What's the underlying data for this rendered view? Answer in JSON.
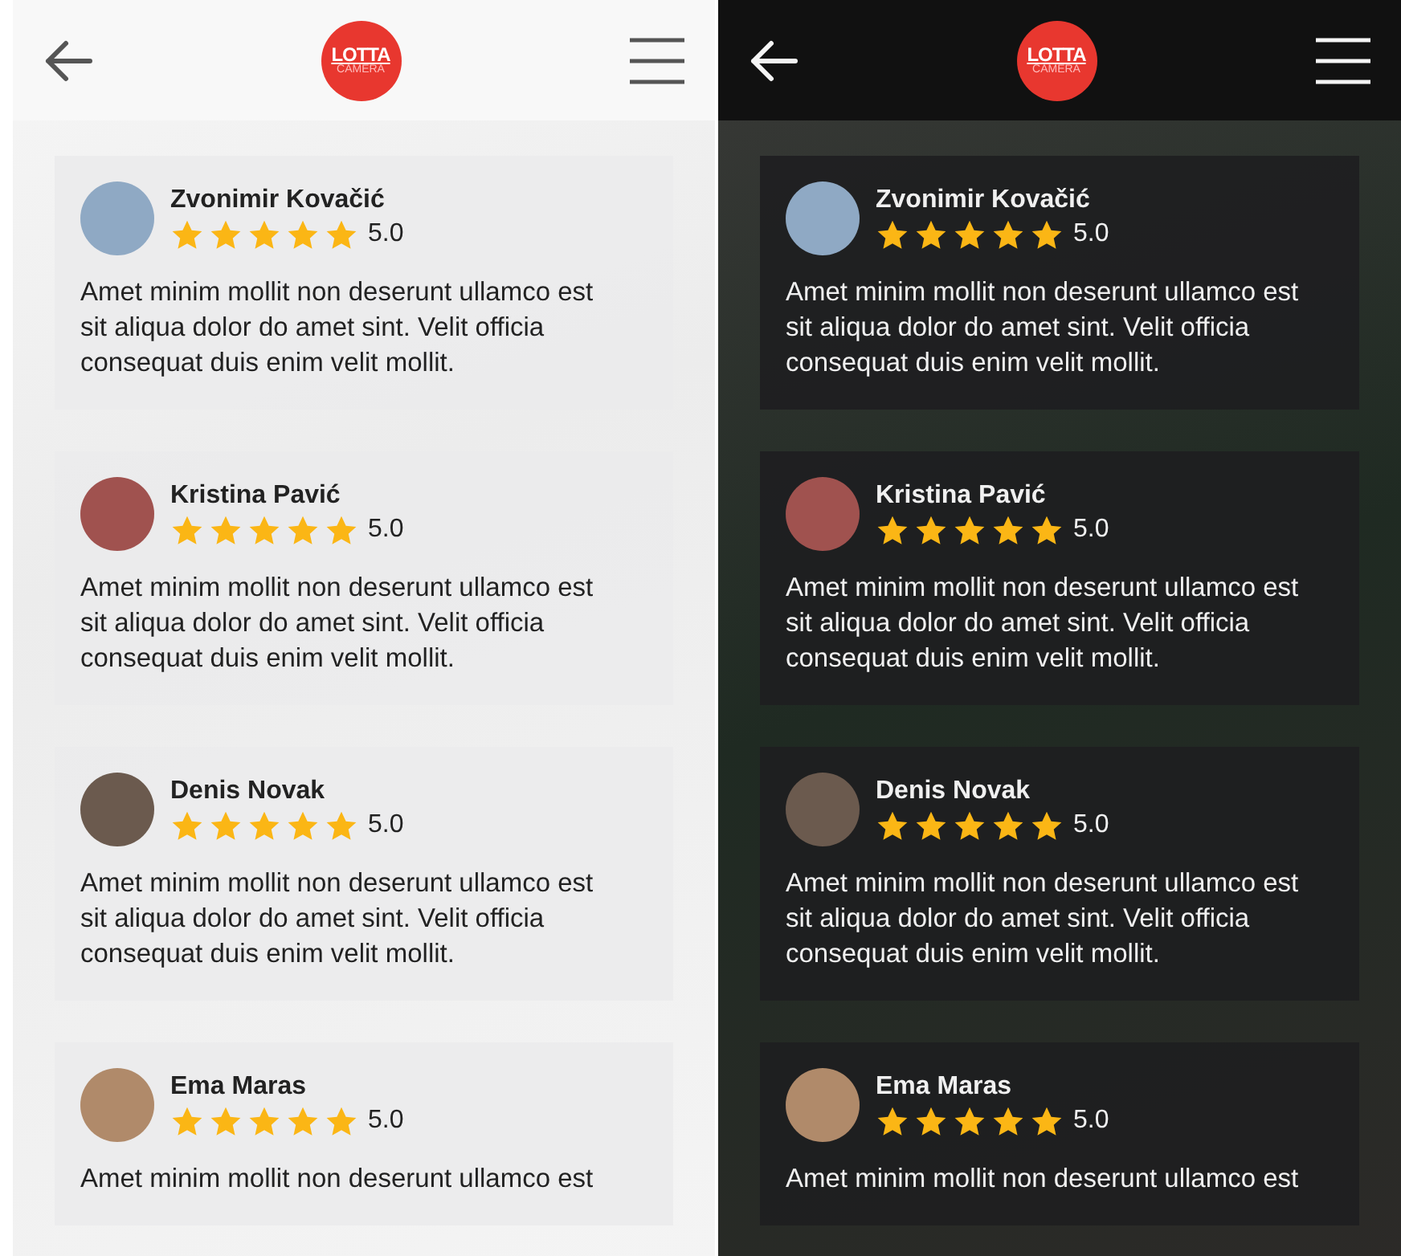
{
  "screens": [
    {
      "kind": "light",
      "logo": {
        "top": "LOTTA",
        "bottom": "CAMERA"
      },
      "reviews": [
        {
          "name": "Zvonimir Kovačić",
          "stars": 5,
          "rating": "5.0",
          "text": "Amet minim mollit non deserunt ullamco est sit aliqua dolor do amet sint. Velit officia consequat duis enim velit mollit."
        },
        {
          "name": "Kristina Pavić",
          "stars": 5,
          "rating": "5.0",
          "text": "Amet minim mollit non deserunt ullamco est sit aliqua dolor do amet sint. Velit officia consequat duis enim velit mollit."
        },
        {
          "name": "Denis Novak",
          "stars": 5,
          "rating": "5.0",
          "text": "Amet minim mollit non deserunt ullamco est sit aliqua dolor do amet sint. Velit officia consequat duis enim velit mollit."
        },
        {
          "name": "Ema Maras",
          "stars": 5,
          "rating": "5.0",
          "text": "Amet minim mollit non deserunt ullamco est"
        }
      ]
    },
    {
      "kind": "dark",
      "logo": {
        "top": "LOTTA",
        "bottom": "CAMERA"
      },
      "reviews": [
        {
          "name": "Zvonimir Kovačić",
          "stars": 5,
          "rating": "5.0",
          "text": "Amet minim mollit non deserunt ullamco est sit aliqua dolor do amet sint. Velit officia consequat duis enim velit mollit."
        },
        {
          "name": "Kristina Pavić",
          "stars": 5,
          "rating": "5.0",
          "text": "Amet minim mollit non deserunt ullamco est sit aliqua dolor do amet sint. Velit officia consequat duis enim velit mollit."
        },
        {
          "name": "Denis Novak",
          "stars": 5,
          "rating": "5.0",
          "text": "Amet minim mollit non deserunt ullamco est sit aliqua dolor do amet sint. Velit officia consequat duis enim velit mollit."
        },
        {
          "name": "Ema Maras",
          "stars": 5,
          "rating": "5.0",
          "text": "Amet minim mollit non deserunt ullamco est"
        }
      ]
    }
  ]
}
